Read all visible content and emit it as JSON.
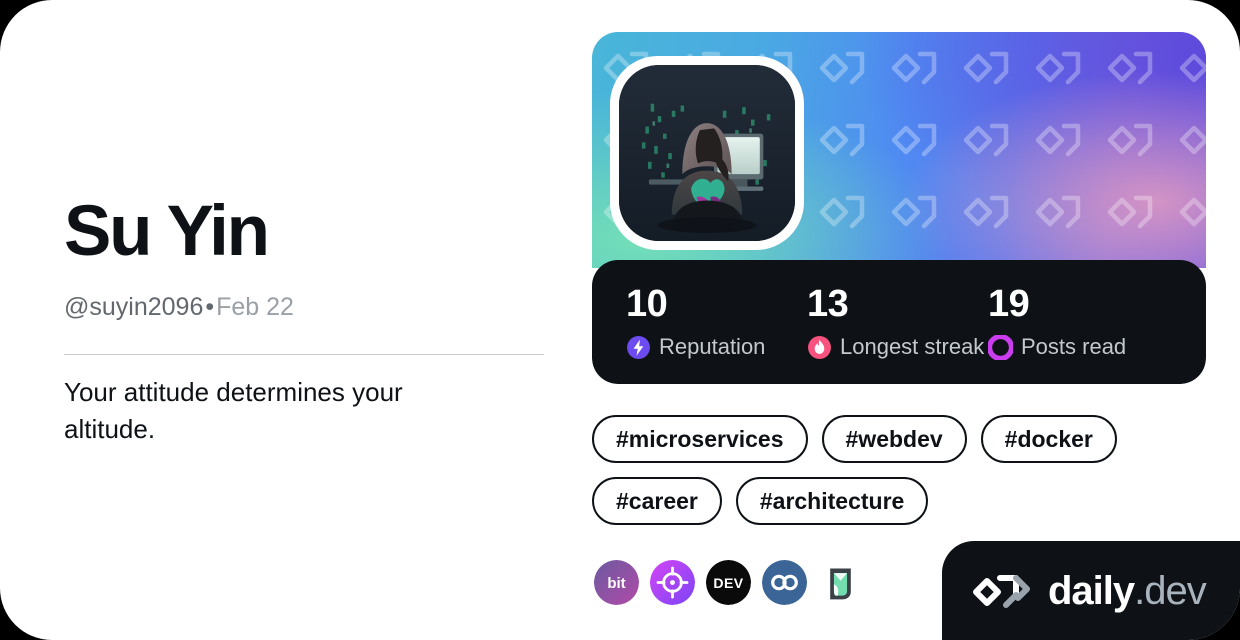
{
  "profile": {
    "display_name": "Su Yin",
    "handle": "@suyin2096",
    "separator": "•",
    "joined_date": "Feb 22",
    "bio": "Your attitude determines your altitude."
  },
  "stats": [
    {
      "value": "10",
      "label": "Reputation",
      "icon": "reputation-bolt-icon",
      "color": "#6c4cf0"
    },
    {
      "value": "13",
      "label": "Longest streak",
      "icon": "streak-flame-icon",
      "color": "#f8527e"
    },
    {
      "value": "19",
      "label": "Posts read",
      "icon": "posts-read-ring-icon",
      "color": "#cd3df0"
    }
  ],
  "tags": [
    {
      "label": "#microservices"
    },
    {
      "label": "#webdev"
    },
    {
      "label": "#docker"
    },
    {
      "label": "#career"
    },
    {
      "label": "#architecture"
    }
  ],
  "sources": [
    {
      "name": "bit-source-icon",
      "title": "bit"
    },
    {
      "name": "crosshair-source-icon",
      "title": "target"
    },
    {
      "name": "devto-source-icon",
      "title": "DEV"
    },
    {
      "name": "infinity-source-icon",
      "title": "infinity"
    },
    {
      "name": "mint-glass-source-icon",
      "title": "mint"
    }
  ],
  "brand": {
    "name_primary": "daily",
    "name_suffix": ".dev",
    "logo": "daily-dev-logo-icon"
  },
  "theme": {
    "card_background": "#ffffff",
    "page_background": "#000000",
    "text_primary": "#0e1217",
    "text_secondary": "#62686d",
    "text_tertiary": "#9aa0a6",
    "dark_panel": "#0e1217",
    "divider": "#c9ccd0"
  },
  "avatar": {
    "name": "user-avatar",
    "description": "hooded figure seated at computer"
  },
  "cover": {
    "name": "profile-cover-banner",
    "description": "blue teal purple gradient with daily.dev logo watermark pattern"
  }
}
